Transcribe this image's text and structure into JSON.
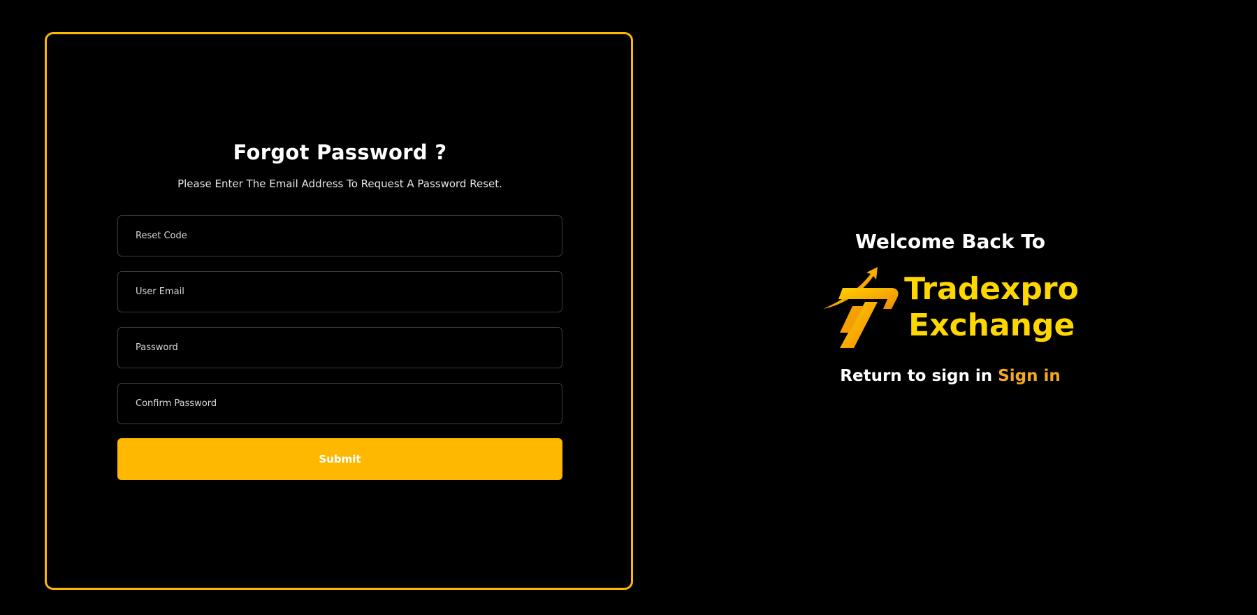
{
  "form": {
    "title": "Forgot Password ?",
    "subtitle": "Please Enter The Email Address To Request A Password Reset.",
    "fields": [
      {
        "placeholder": "Reset Code",
        "value": ""
      },
      {
        "placeholder": "User Email",
        "value": ""
      },
      {
        "placeholder": "Password",
        "value": ""
      },
      {
        "placeholder": "Confirm Password",
        "value": ""
      }
    ],
    "submit_label": "Submit"
  },
  "brand": {
    "welcome": "Welcome Back To",
    "logo_line1": "Tradexpro",
    "logo_line2": "Exchange",
    "logo_icon": "arrow-seven-logo-icon"
  },
  "signin": {
    "prompt": "Return to sign in",
    "link_label": "Sign in"
  },
  "colors": {
    "accent": "#FFB800",
    "logo_text": "#FFD700",
    "link": "#F5A623",
    "background": "#000000"
  }
}
